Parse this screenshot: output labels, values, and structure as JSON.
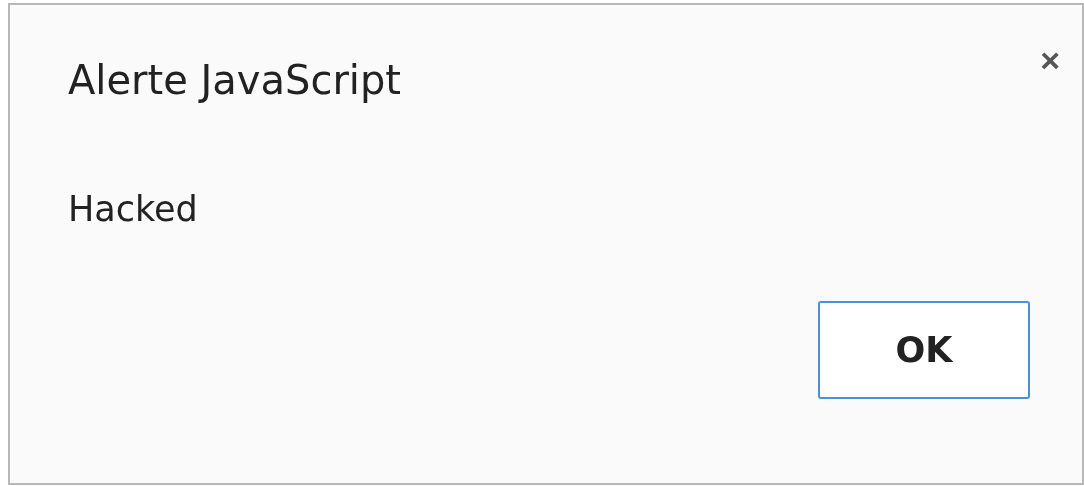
{
  "dialog": {
    "title": "Alerte JavaScript",
    "close": "×",
    "message": "Hacked",
    "buttons": [
      {
        "label": "OK",
        "focused": true
      }
    ]
  }
}
